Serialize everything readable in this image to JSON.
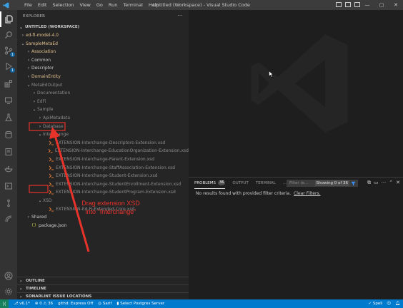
{
  "window": {
    "title": "Untitled (Workspace) - Visual Studio Code",
    "menu": [
      "File",
      "Edit",
      "Selection",
      "View",
      "Go",
      "Run",
      "Terminal",
      "Help"
    ]
  },
  "activity": {
    "badges": {
      "source_control": "1",
      "run": "1"
    }
  },
  "explorer": {
    "header": "EXPLORER",
    "more": "···",
    "workspace": "UNTITLED (WORKSPACE)",
    "tree": [
      {
        "label": "ed-fi-model-4.0",
        "depth": 0,
        "chev": "›",
        "color": "yellow"
      },
      {
        "label": "SampleMetaEd",
        "depth": 0,
        "chev": "⌄",
        "color": "yellow"
      },
      {
        "label": "Association",
        "depth": 1,
        "chev": "›",
        "color": "yellow"
      },
      {
        "label": "Common",
        "depth": 1,
        "chev": "›",
        "color": "white"
      },
      {
        "label": "Descriptor",
        "depth": 1,
        "chev": "›",
        "color": "white"
      },
      {
        "label": "DomainEntity",
        "depth": 1,
        "chev": "›",
        "color": "yellow"
      },
      {
        "label": "MetaEdOutput",
        "depth": 1,
        "chev": "⌄",
        "color": "gray"
      },
      {
        "label": "Documentation",
        "depth": 2,
        "chev": "›",
        "color": "gray"
      },
      {
        "label": "EdFi",
        "depth": 2,
        "chev": "›",
        "color": "gray"
      },
      {
        "label": "Sample",
        "depth": 2,
        "chev": "⌄",
        "color": "gray"
      },
      {
        "label": "ApiMetadata",
        "depth": 3,
        "chev": "›",
        "color": "gray"
      },
      {
        "label": "Database",
        "depth": 3,
        "chev": "›",
        "color": "gray"
      },
      {
        "label": "Interchange",
        "depth": 3,
        "chev": "⌄",
        "color": "gray"
      },
      {
        "label": "EXTENSION-Interchange-Descriptors-Extension.xsd",
        "depth": 4,
        "file": true
      },
      {
        "label": "EXTENSION-Interchange-EducationOrganization-Extension.xsd",
        "depth": 4,
        "file": true
      },
      {
        "label": "EXTENSION-Interchange-Parent-Extension.xsd",
        "depth": 4,
        "file": true
      },
      {
        "label": "EXTENSION-Interchange-StaffAssociation-Extension.xsd",
        "depth": 4,
        "file": true
      },
      {
        "label": "EXTENSION-Interchange-Student-Extension.xsd",
        "depth": 4,
        "file": true
      },
      {
        "label": "EXTENSION-Interchange-StudentEnrollment-Extension.xsd",
        "depth": 4,
        "file": true
      },
      {
        "label": "EXTENSION-Interchange-StudentProgram-Extension.xsd",
        "depth": 4,
        "file": true
      },
      {
        "label": "XSD",
        "depth": 3,
        "chev": "⌄",
        "color": "gray"
      },
      {
        "label": "EXTENSION-Ed-Fi-Extended-Core.xsd",
        "depth": 4,
        "file": true
      },
      {
        "label": "Shared",
        "depth": 1,
        "chev": "›",
        "color": "white"
      },
      {
        "label": "package.json",
        "depth": 1,
        "json": true,
        "color": "white"
      }
    ],
    "sections": [
      "OUTLINE",
      "TIMELINE",
      "SONARLINT ISSUE LOCATIONS"
    ]
  },
  "panel": {
    "tabs": [
      {
        "label": "PROBLEMS",
        "count": "36",
        "active": true
      },
      {
        "label": "OUTPUT"
      },
      {
        "label": "TERMINAL"
      },
      {
        "label": "..."
      }
    ],
    "filter_placeholder": "Filter (e...",
    "showing": "Showing 0 of 36",
    "message": "No results found with provided filter criteria.",
    "clear_link": "Clear Filters."
  },
  "status": {
    "version": "v6.1*",
    "errors": "0",
    "warnings": "36",
    "git": "githd: Express Off",
    "sarif": "Sarif",
    "postgres": "Select Postgres Server",
    "spell": "Spell"
  },
  "annotation": {
    "text": "Drag extension XSD into \"Interchange\"",
    "color": "#e8332a"
  },
  "colors": {
    "accent": "#007acc",
    "remote": "#16825d",
    "sidebar": "#252526",
    "editor": "#1e1e1e"
  }
}
